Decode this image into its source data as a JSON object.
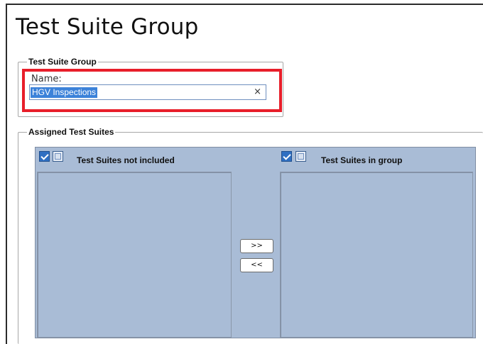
{
  "page": {
    "title": "Test Suite Group"
  },
  "group_box": {
    "legend": "Test Suite Group",
    "name_label": "Name:",
    "name_value": "HGV Inspections",
    "clear_icon": "close-icon",
    "clear_glyph": "×"
  },
  "assigned": {
    "legend": "Assigned Test Suites",
    "left": {
      "title": "Test Suites not included",
      "select_all_checked": true,
      "items": []
    },
    "right": {
      "title": "Test Suites in group",
      "select_all_checked": true,
      "items": []
    },
    "add_label": ">>",
    "remove_label": "<<"
  },
  "colors": {
    "highlight": "#e81e2a",
    "panel_bg": "#a9bcd6",
    "selection": "#3c82d9"
  }
}
